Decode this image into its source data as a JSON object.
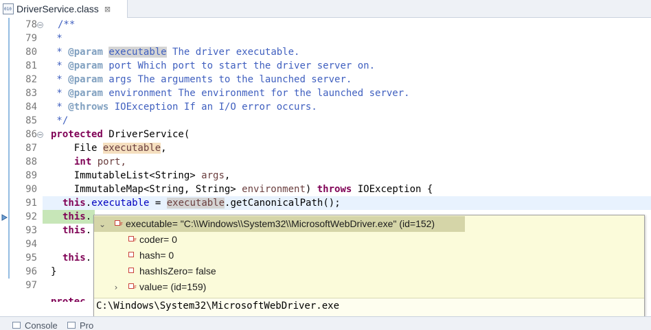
{
  "tab": {
    "title": "DriverService.class",
    "close_glyph": "⊠"
  },
  "editor": {
    "lines": [
      {
        "num": "78",
        "fold": true
      },
      {
        "num": "79"
      },
      {
        "num": "80"
      },
      {
        "num": "81"
      },
      {
        "num": "82"
      },
      {
        "num": "83"
      },
      {
        "num": "84"
      },
      {
        "num": "85"
      },
      {
        "num": "86",
        "fold": true
      },
      {
        "num": "87"
      },
      {
        "num": "88"
      },
      {
        "num": "89"
      },
      {
        "num": "90"
      },
      {
        "num": "91"
      },
      {
        "num": "92"
      },
      {
        "num": "93"
      },
      {
        "num": "94"
      },
      {
        "num": "95"
      },
      {
        "num": "96"
      },
      {
        "num": "97"
      }
    ],
    "tokens": {
      "l78": "/**",
      "l79": " *",
      "l80_a": " * ",
      "l80_tag": "@param",
      "l80_b": " ",
      "l80_sel": "executable",
      "l80_c": " The driver executable.",
      "l81_a": " * ",
      "l81_tag": "@param",
      "l81_b": " port Which port to start the driver server on.",
      "l82_a": " * ",
      "l82_tag": "@param",
      "l82_b": " args The arguments to the launched server.",
      "l83_a": " * ",
      "l83_tag": "@param",
      "l83_b": " environment The environment for the launched server.",
      "l84_a": " * ",
      "l84_tag": "@throws",
      "l84_b": " IOException If an I/O error occurs.",
      "l85": " */",
      "l86_kw": "protected",
      "l86_b": " DriverService(",
      "l87_a": "    File ",
      "l87_hl": "executable",
      "l87_b": ",",
      "l88_kw": "int",
      "l88_b": " port,",
      "l89_a": "    ImmutableList<String> ",
      "l89_var": "args",
      "l89_b": ",",
      "l90_a": "    ImmutableMap<String, String> ",
      "l90_var": "environment",
      "l90_b": ") ",
      "l90_kw": "throws",
      "l90_c": " IOException {",
      "l91_kw": "this",
      "l91_b": ".",
      "l91_fld": "executable",
      "l91_c": " = ",
      "l91_hl": "executable",
      "l91_d": ".getCanonicalPath();",
      "l92_kw": "this",
      "l92_b": ".",
      "l93_kw": "this",
      "l93_b": ".",
      "l95_kw": "this",
      "l95_b": ".",
      "l96": "}",
      "l97_partial": "  protec"
    }
  },
  "popup": {
    "root": "executable= \"C:\\\\Windows\\\\System32\\\\MicrosoftWebDriver.exe\" (id=152)",
    "children": [
      "coder= 0",
      "hash= 0",
      "hashIsZero= false",
      "value= (id=159)"
    ],
    "detail": "C:\\Windows\\System32\\MicrosoftWebDriver.exe"
  },
  "bottom_tabs": [
    "Console",
    "Pro"
  ]
}
